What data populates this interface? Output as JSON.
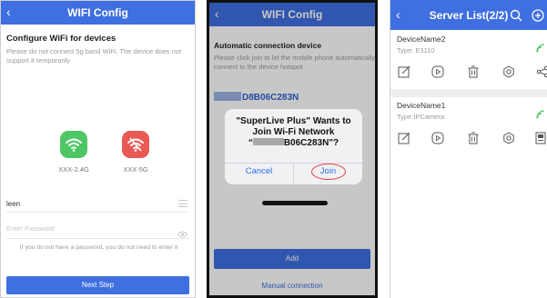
{
  "panel1": {
    "back_icon": "chevron-left-icon",
    "title": "WIFI Config",
    "heading": "Configure WiFi for devices",
    "description": "Please do not connect 5g band WiFi. The device does not support it temporarily",
    "bands": [
      {
        "label": "XXX-2.4G",
        "icon": "wifi-icon",
        "color": "#4cc764"
      },
      {
        "label": "XXX-5G",
        "icon": "wifi-off-icon",
        "color": "#ea5a55"
      }
    ],
    "ssid_value": "leen",
    "password_placeholder": "Enter Password",
    "hint": "If you do not have a password, you do not need to enter it",
    "next_button": "Next Step"
  },
  "panel2": {
    "back_icon": "chevron-left-icon",
    "title": "WIFI Config",
    "heading": "Automatic connection device",
    "description": "Please click join to let the mobile phone automatically connect to the device hotspot",
    "device_id_visible": "D8B06C283N",
    "dialog": {
      "line1": "\"SuperLive Plus\" Wants to",
      "line2": "Join Wi-Fi Network",
      "line3_suffix": "B06C283N\"?",
      "cancel": "Cancel",
      "join": "Join"
    },
    "add_button": "Add",
    "manual_link": "Manual connection"
  },
  "panel3": {
    "back_icon": "chevron-left-icon",
    "title": "Server List(2/2)",
    "devices": [
      {
        "name": "DeviceName2",
        "type": "Type: E3110"
      },
      {
        "name": "DeviceName1",
        "type": "Type:IPCamera"
      }
    ],
    "accent": "#3f6fe0",
    "wifi_color": "#4cc764"
  }
}
